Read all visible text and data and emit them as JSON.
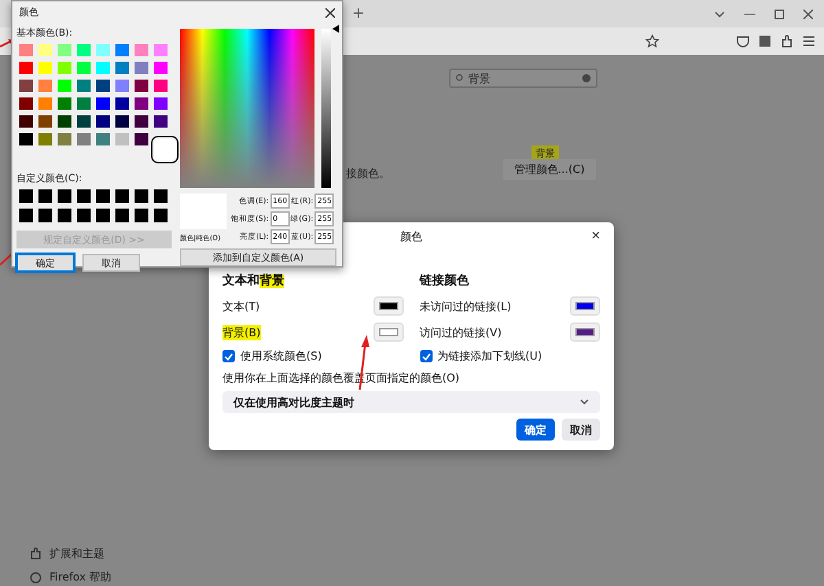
{
  "browser": {
    "new_tab": "+",
    "search": {
      "value": "背景"
    },
    "highlight_badge": "背景",
    "manage_colors_button": "管理颜色...(C)",
    "cut_text": "接颜色。",
    "sidebar": [
      {
        "kind": "extensions",
        "label": "扩展和主题"
      },
      {
        "kind": "help",
        "label": "Firefox 帮助"
      }
    ]
  },
  "color_picker": {
    "title": "颜色",
    "basic_label": "基本颜色(B):",
    "basic_colors": [
      [
        {
          "color": "#ff8080",
          "selected": false
        },
        {
          "color": "#ffff80",
          "selected": false
        },
        {
          "color": "#80ff80",
          "selected": false
        },
        {
          "color": "#00ff80",
          "selected": false
        },
        {
          "color": "#80ffff",
          "selected": false
        },
        {
          "color": "#0080ff",
          "selected": false
        },
        {
          "color": "#ff80c0",
          "selected": false
        },
        {
          "color": "#ff80ff",
          "selected": false
        }
      ],
      [
        {
          "color": "#ff0000",
          "selected": false
        },
        {
          "color": "#ffff00",
          "selected": false
        },
        {
          "color": "#80ff00",
          "selected": false
        },
        {
          "color": "#00ff40",
          "selected": false
        },
        {
          "color": "#00ffff",
          "selected": false
        },
        {
          "color": "#0080c0",
          "selected": false
        },
        {
          "color": "#8080c0",
          "selected": false
        },
        {
          "color": "#ff00ff",
          "selected": false
        }
      ],
      [
        {
          "color": "#804040",
          "selected": false
        },
        {
          "color": "#ff8040",
          "selected": false
        },
        {
          "color": "#00ff00",
          "selected": false
        },
        {
          "color": "#008080",
          "selected": false
        },
        {
          "color": "#004080",
          "selected": false
        },
        {
          "color": "#8080ff",
          "selected": false
        },
        {
          "color": "#800040",
          "selected": false
        },
        {
          "color": "#ff0080",
          "selected": false
        }
      ],
      [
        {
          "color": "#800000",
          "selected": false
        },
        {
          "color": "#ff8000",
          "selected": false
        },
        {
          "color": "#008000",
          "selected": false
        },
        {
          "color": "#008040",
          "selected": false
        },
        {
          "color": "#0000ff",
          "selected": false
        },
        {
          "color": "#0000a0",
          "selected": false
        },
        {
          "color": "#800080",
          "selected": false
        },
        {
          "color": "#8000ff",
          "selected": false
        }
      ],
      [
        {
          "color": "#400000",
          "selected": false
        },
        {
          "color": "#804000",
          "selected": false
        },
        {
          "color": "#004000",
          "selected": false
        },
        {
          "color": "#004040",
          "selected": false
        },
        {
          "color": "#000080",
          "selected": false
        },
        {
          "color": "#000040",
          "selected": false
        },
        {
          "color": "#400040",
          "selected": false
        },
        {
          "color": "#400080",
          "selected": false
        }
      ],
      [
        {
          "color": "#000000",
          "selected": false
        },
        {
          "color": "#808000",
          "selected": false
        },
        {
          "color": "#808040",
          "selected": false
        },
        {
          "color": "#808080",
          "selected": false
        },
        {
          "color": "#408080",
          "selected": false
        },
        {
          "color": "#c0c0c0",
          "selected": false
        },
        {
          "color": "#400040",
          "selected": false
        },
        {
          "color": "#ffffff",
          "selected": true
        }
      ]
    ],
    "custom_label": "自定义颜色(C):",
    "custom_colors": [
      {
        "color": "#000000"
      },
      {
        "color": "#000000"
      },
      {
        "color": "#000000"
      },
      {
        "color": "#000000"
      },
      {
        "color": "#000000"
      },
      {
        "color": "#000000"
      },
      {
        "color": "#000000"
      },
      {
        "color": "#000000"
      },
      {
        "color": "#000000"
      },
      {
        "color": "#000000"
      },
      {
        "color": "#000000"
      },
      {
        "color": "#000000"
      },
      {
        "color": "#000000"
      },
      {
        "color": "#000000"
      },
      {
        "color": "#000000"
      },
      {
        "color": "#000000"
      }
    ],
    "luminance_slider": {
      "level": 1
    },
    "define_button": {
      "label": "规定自定义颜色(D) >>",
      "disabled": true
    },
    "ok_button": "确定",
    "cancel_button": "取消",
    "preview_label": "颜色|纯色(O)",
    "fields": [
      {
        "label": "色调(E):",
        "value": "160"
      },
      {
        "label": "红(R):",
        "value": "255"
      },
      {
        "label": "饱和度(S):",
        "value": "0"
      },
      {
        "label": "绿(G):",
        "value": "255"
      },
      {
        "label": "亮度(L):",
        "value": "240"
      },
      {
        "label": "蓝(U):",
        "value": "255"
      }
    ],
    "add_button": "添加到自定义颜色(A)"
  },
  "colors_dialog": {
    "title": "颜色",
    "close": "×",
    "text_heading": [
      {
        "text": "文本和",
        "highlighted": false
      },
      {
        "text": "背景",
        "highlighted": true
      }
    ],
    "link_heading": "链接颜色",
    "rows": [
      {
        "label": "文本(T)",
        "highlighted": false,
        "color": "#000000"
      },
      {
        "label": "未访问过的链接(L)",
        "highlighted": false,
        "color": "#0000ee"
      },
      {
        "label": "背景(B)",
        "highlighted": true,
        "color": "#ffffff"
      },
      {
        "label": "访问过的链接(V)",
        "highlighted": false,
        "color": "#551a8b"
      }
    ],
    "checkboxes": [
      {
        "label": "使用系统颜色(S)",
        "checked": true
      },
      {
        "label": "为链接添加下划线(U)",
        "checked": true
      }
    ],
    "override_label": "使用你在上面选择的颜色覆盖页面指定的颜色(O)",
    "override_select": "仅在使用高对比度主题时",
    "ok_button": "确定",
    "cancel_button": "取消"
  }
}
